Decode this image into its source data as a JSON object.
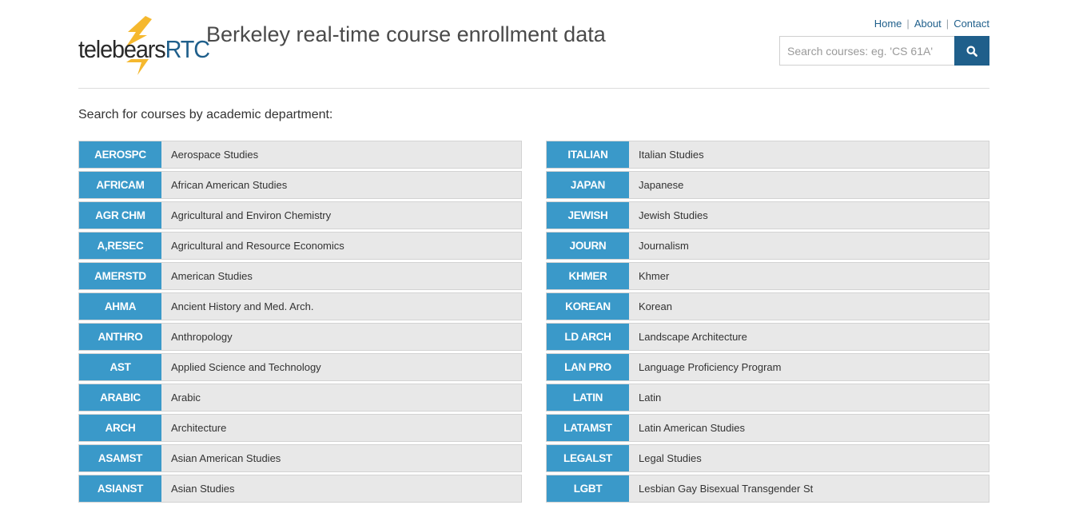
{
  "logo": {
    "brand_part1": "telebears",
    "brand_part2": "RTC",
    "bolt_color": "#f5b82e"
  },
  "header": {
    "site_title": "Berkeley real-time course enrollment data"
  },
  "nav": {
    "home": "Home",
    "about": "About",
    "contact": "Contact",
    "separator": "|"
  },
  "search": {
    "placeholder": "Search courses: eg. 'CS 61A'",
    "value": "",
    "button_icon": "search-icon"
  },
  "main": {
    "heading": "Search for courses by academic department:"
  },
  "colors": {
    "accent": "#1f5f8b",
    "code_bg": "#3a99c9",
    "row_bg": "#e8e8e8"
  },
  "departments_left": [
    {
      "code": "AEROSPC",
      "name": "Aerospace Studies"
    },
    {
      "code": "AFRICAM",
      "name": "African American Studies"
    },
    {
      "code": "AGR CHM",
      "name": "Agricultural and Environ Chemistry"
    },
    {
      "code": "A,RESEC",
      "name": "Agricultural and Resource Economics"
    },
    {
      "code": "AMERSTD",
      "name": "American Studies"
    },
    {
      "code": "AHMA",
      "name": "Ancient History and Med. Arch."
    },
    {
      "code": "ANTHRO",
      "name": "Anthropology"
    },
    {
      "code": "AST",
      "name": "Applied Science and Technology"
    },
    {
      "code": "ARABIC",
      "name": "Arabic"
    },
    {
      "code": "ARCH",
      "name": "Architecture"
    },
    {
      "code": "ASAMST",
      "name": "Asian American Studies"
    },
    {
      "code": "ASIANST",
      "name": "Asian Studies"
    }
  ],
  "departments_right": [
    {
      "code": "ITALIAN",
      "name": "Italian Studies"
    },
    {
      "code": "JAPAN",
      "name": "Japanese"
    },
    {
      "code": "JEWISH",
      "name": "Jewish Studies"
    },
    {
      "code": "JOURN",
      "name": "Journalism"
    },
    {
      "code": "KHMER",
      "name": "Khmer"
    },
    {
      "code": "KOREAN",
      "name": "Korean"
    },
    {
      "code": "LD ARCH",
      "name": "Landscape Architecture"
    },
    {
      "code": "LAN PRO",
      "name": "Language Proficiency Program"
    },
    {
      "code": "LATIN",
      "name": "Latin"
    },
    {
      "code": "LATAMST",
      "name": "Latin American Studies"
    },
    {
      "code": "LEGALST",
      "name": "Legal Studies"
    },
    {
      "code": "LGBT",
      "name": "Lesbian Gay Bisexual Transgender St"
    }
  ]
}
